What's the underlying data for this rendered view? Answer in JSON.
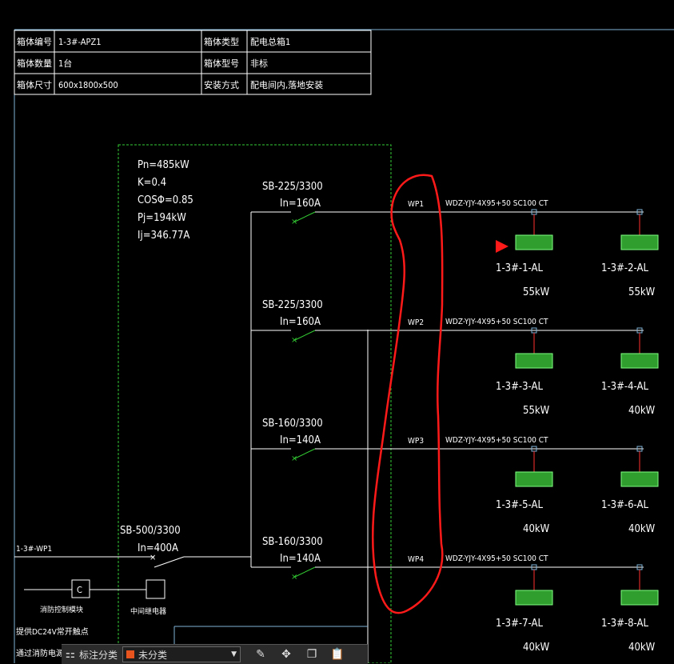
{
  "info_table": {
    "rows": [
      [
        "箱体编号",
        "1-3#-APZ1",
        "箱体类型",
        "配电总箱1"
      ],
      [
        "箱体数量",
        "1台",
        "箱体型号",
        "非标"
      ],
      [
        "箱体尺寸",
        "600x1800x500",
        "安装方式",
        "配电间内,落地安装"
      ]
    ]
  },
  "load_params": [
    "Pn=485kW",
    "K=0.4",
    "COSΦ=0.85",
    "Pj=194kW",
    "Ij=346.77A"
  ],
  "main_breaker": {
    "model": "SB-500/3300",
    "rating": "In=400A",
    "incoming": "1-3#-WP1"
  },
  "branches": [
    {
      "breaker": "SB-225/3300",
      "rating": "In=160A",
      "circuit": "WP1",
      "cable": "WDZ-YJY-4X95+50 SC100 CT",
      "loads": [
        {
          "name": "1-3#-1-AL",
          "power": "55kW"
        },
        {
          "name": "1-3#-2-AL",
          "power": "55kW"
        }
      ]
    },
    {
      "breaker": "SB-225/3300",
      "rating": "In=160A",
      "circuit": "WP2",
      "cable": "WDZ-YJY-4X95+50 SC100 CT",
      "loads": [
        {
          "name": "1-3#-3-AL",
          "power": "55kW"
        },
        {
          "name": "1-3#-4-AL",
          "power": "40kW"
        }
      ]
    },
    {
      "breaker": "SB-160/3300",
      "rating": "In=140A",
      "circuit": "WP3",
      "cable": "WDZ-YJY-4X95+50 SC100 CT",
      "loads": [
        {
          "name": "1-3#-5-AL",
          "power": "40kW"
        },
        {
          "name": "1-3#-6-AL",
          "power": "40kW"
        }
      ]
    },
    {
      "breaker": "SB-160/3300",
      "rating": "In=140A",
      "circuit": "WP4",
      "cable": "WDZ-YJY-4X95+50 SC100 CT",
      "loads": [
        {
          "name": "1-3#-7-AL",
          "power": "40kW"
        },
        {
          "name": "1-3#-8-AL",
          "power": "40kW"
        }
      ]
    }
  ],
  "bottom_left": {
    "contactor_symbol": "C",
    "label1": "消防控制模块",
    "label2": "中间继电器",
    "note1": "提供DC24V常开触点",
    "note2": "通过消防电源监控系统"
  },
  "toolbar": {
    "category_label": "标注分类",
    "dropdown_value": "未分类",
    "swatch_color": "#e8541e"
  },
  "colors": {
    "wire": "#ffffff",
    "breaker": "#33cc33",
    "dashed_box": "#33cc33",
    "highlight": "#ff1a1a",
    "load_box": "#2f9e2f"
  }
}
